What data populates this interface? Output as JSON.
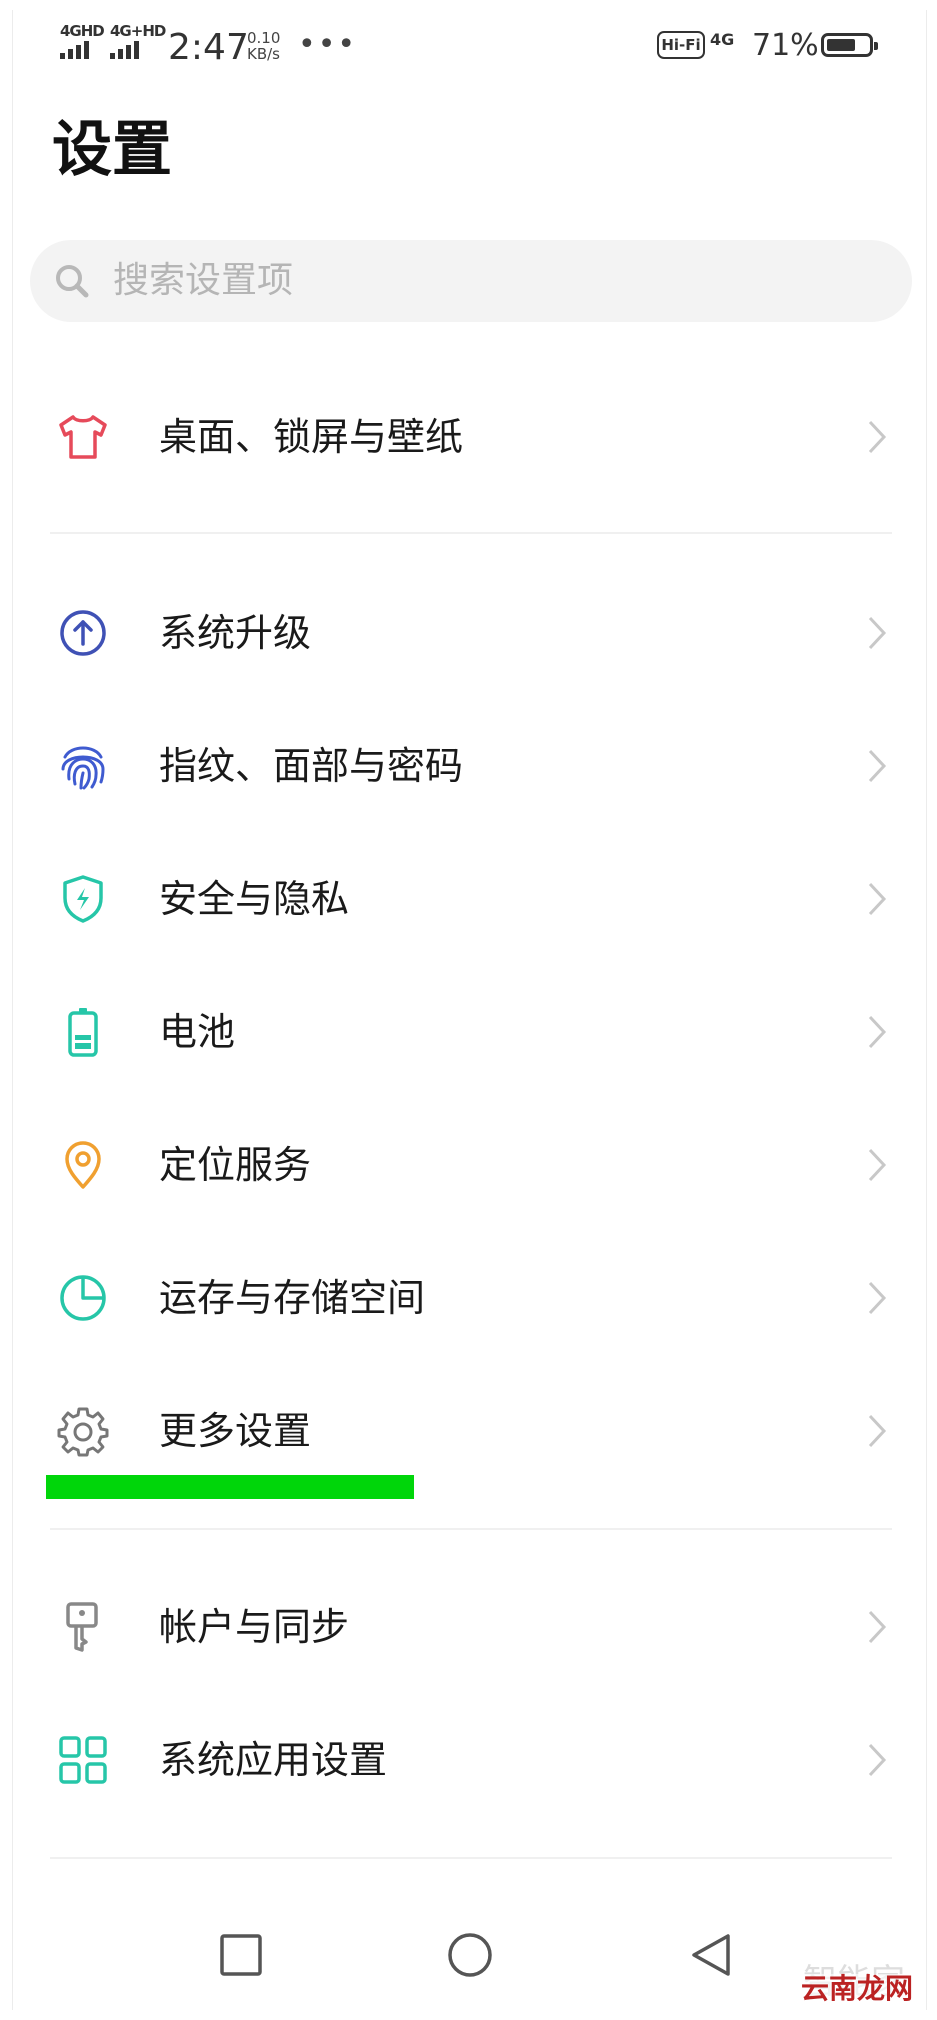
{
  "status_bar": {
    "sim1": "4GHD",
    "sim2": "4G+HD",
    "time": "2:47",
    "speed_value": "0.10",
    "speed_unit": "KB/s",
    "more": "•••",
    "hifi": "Hi-Fi",
    "network": "4G",
    "battery_percent": "71%",
    "battery_level": 0.71
  },
  "page": {
    "title": "设置"
  },
  "search": {
    "placeholder": "搜索设置项"
  },
  "items": [
    {
      "label": "桌面、锁屏与壁纸",
      "icon": "tshirt-icon",
      "color": "#e64a5a"
    },
    {
      "label": "系统升级",
      "icon": "upgrade-arrow-icon",
      "color": "#3f51b5"
    },
    {
      "label": "指纹、面部与密码",
      "icon": "fingerprint-icon",
      "color": "#3f5bd0"
    },
    {
      "label": "安全与隐私",
      "icon": "shield-icon",
      "color": "#26c6a8"
    },
    {
      "label": "电池",
      "icon": "battery-icon",
      "color": "#26c6a8"
    },
    {
      "label": "定位服务",
      "icon": "location-pin-icon",
      "color": "#f0a030"
    },
    {
      "label": "运存与存储空间",
      "icon": "pie-chart-icon",
      "color": "#26c6a8"
    },
    {
      "label": "更多设置",
      "icon": "gear-icon",
      "color": "#777777"
    },
    {
      "label": "帐户与同步",
      "icon": "key-icon",
      "color": "#888888"
    },
    {
      "label": "系统应用设置",
      "icon": "apps-grid-icon",
      "color": "#26c6a8"
    }
  ],
  "watermark": {
    "text": "智能家",
    "site": "云南龙网"
  }
}
